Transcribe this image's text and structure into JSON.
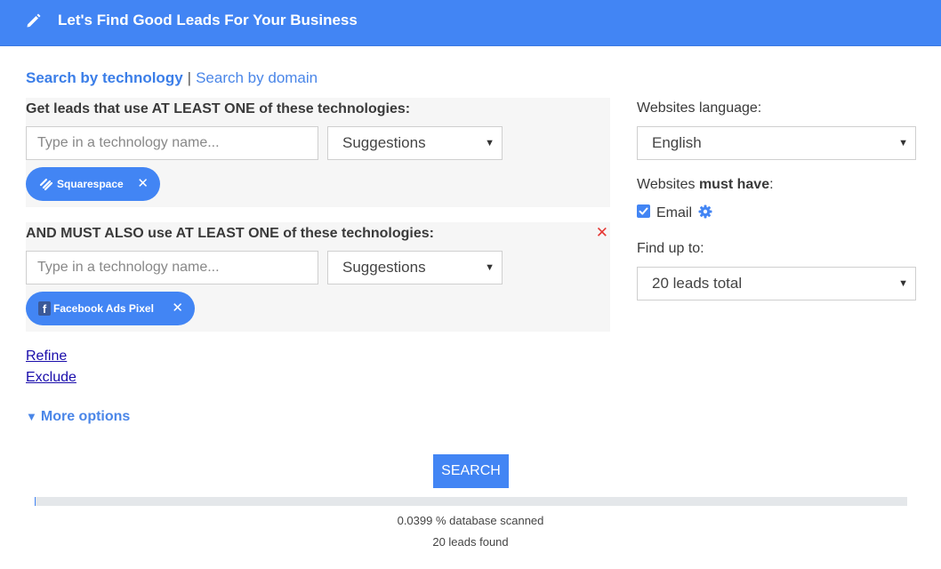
{
  "header": {
    "title": "Let's Find Good Leads For Your Business",
    "icon": "pencil-icon"
  },
  "mode": {
    "active": "Search by technology",
    "separator": "|",
    "other": "Search by domain"
  },
  "group1": {
    "title": "Get leads that use AT LEAST ONE of these technologies:",
    "input_placeholder": "Type in a technology name...",
    "suggestions": "Suggestions",
    "chip": {
      "label": "Squarespace",
      "icon": "squarespace-icon"
    }
  },
  "group2": {
    "title": "AND MUST ALSO use AT LEAST ONE of these technologies:",
    "input_placeholder": "Type in a technology name...",
    "suggestions": "Suggestions",
    "chip": {
      "label": "Facebook Ads Pixel",
      "icon": "facebook-icon"
    }
  },
  "links": {
    "refine": "Refine",
    "exclude": "Exclude"
  },
  "more_options": "More options",
  "right": {
    "language_label": "Websites language:",
    "language_value": "English",
    "must_have_prefix": "Websites ",
    "must_have_bold": "must have",
    "must_have_suffix": ":",
    "email_label": "Email",
    "email_checked": true,
    "find_label": "Find up to:",
    "find_value": "20 leads total"
  },
  "search_button": "SEARCH",
  "progress": {
    "fraction": 0.000399
  },
  "status": {
    "scanned": "0.0399 % database scanned",
    "found": "20 leads found"
  },
  "colors": {
    "accent": "#4285f4",
    "remove": "#e53935",
    "link": "#1a0dab"
  }
}
